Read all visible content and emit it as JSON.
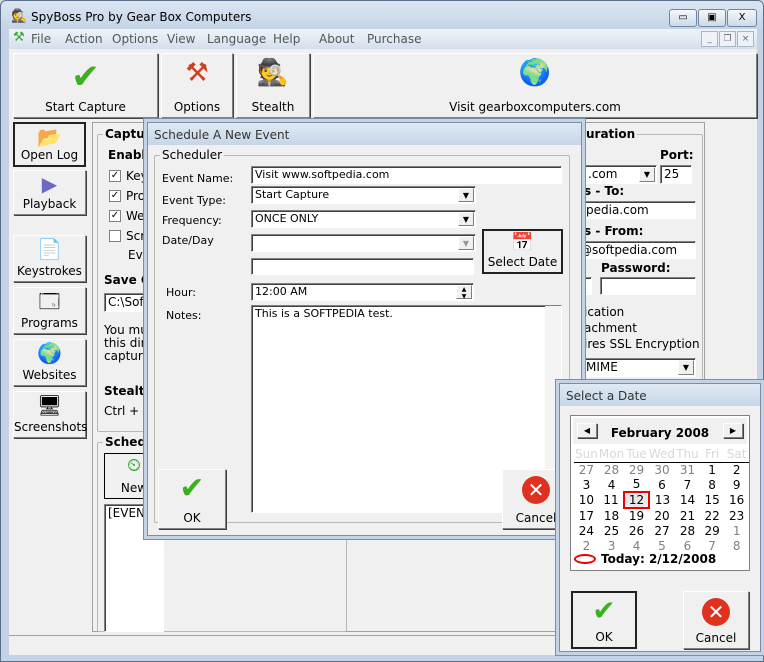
{
  "window": {
    "title": "SpyBoss Pro by Gear Box Computers",
    "min": "▭",
    "max": "▣",
    "close": "X"
  },
  "menu": [
    "File",
    "Action",
    "Options",
    "View",
    "Language",
    "Help",
    "About",
    "Purchase"
  ],
  "toolbar": {
    "start": "Start Capture",
    "options": "Options",
    "stealth": "Stealth",
    "visit": "Visit gearboxcomputers.com"
  },
  "sidebar": [
    "Open Log",
    "Playback",
    "Keystrokes",
    "Programs",
    "Websites",
    "Screenshots"
  ],
  "main": {
    "capture_title": "Captur",
    "enable": "Enable",
    "checks": [
      {
        "label": "Key",
        "checked": true
      },
      {
        "label": "Proc",
        "checked": true
      },
      {
        "label": "Web",
        "checked": true
      },
      {
        "label": "Scre",
        "checked": false
      }
    ],
    "eve": "Eve",
    "save": "Save C",
    "path": "C:\\Soft",
    "note": [
      "You mu",
      "this dire",
      "capture"
    ],
    "stealth": "Stealth",
    "hotkey": "Ctrl + S",
    "sched": "Schedu",
    "new": "New",
    "list": "[EVENT"
  },
  "config": {
    "title": "uration",
    "port_label": "Port:",
    "server": ".com",
    "port": "25",
    "to_label": "s - To:",
    "to": "pedia.com",
    "from_label": "s - From:",
    "from": "@softpedia.com",
    "password_label": "Password:",
    "opt1": "ication",
    "opt2": "achment",
    "opt3": "ires SSL Encryption",
    "mime": "MIME"
  },
  "dialog": {
    "title": "Schedule A New Event",
    "group": "Scheduler",
    "event_name_label": "Event Name:",
    "event_name": "Visit www.softpedia.com",
    "event_type_label": "Event Type:",
    "event_type": "Start Capture",
    "frequency_label": "Frequency:",
    "frequency": "ONCE ONLY",
    "date_label": "Date/Day",
    "date": "",
    "date2": "",
    "select_date": "Select Date",
    "hour_label": "Hour:",
    "hour": "12:00 AM",
    "notes_label": "Notes:",
    "notes": "This is a SOFTPEDIA test.",
    "ok": "OK",
    "cancel": "Cancel"
  },
  "calendar": {
    "title": "Select a Date",
    "month": "February 2008",
    "days": [
      "Sun",
      "Mon",
      "Tue",
      "Wed",
      "Thu",
      "Fri",
      "Sat"
    ],
    "weeks": [
      [
        "27",
        "28",
        "29",
        "30",
        "31",
        "1",
        "2"
      ],
      [
        "3",
        "4",
        "5",
        "6",
        "7",
        "8",
        "9"
      ],
      [
        "10",
        "11",
        "12",
        "13",
        "14",
        "15",
        "16"
      ],
      [
        "17",
        "18",
        "19",
        "20",
        "21",
        "22",
        "23"
      ],
      [
        "24",
        "25",
        "26",
        "27",
        "28",
        "29",
        "1"
      ],
      [
        "2",
        "3",
        "4",
        "5",
        "6",
        "7",
        "8"
      ]
    ],
    "selected": "12",
    "today": "Today: 2/12/2008",
    "ok": "OK",
    "cancel": "Cancel"
  }
}
